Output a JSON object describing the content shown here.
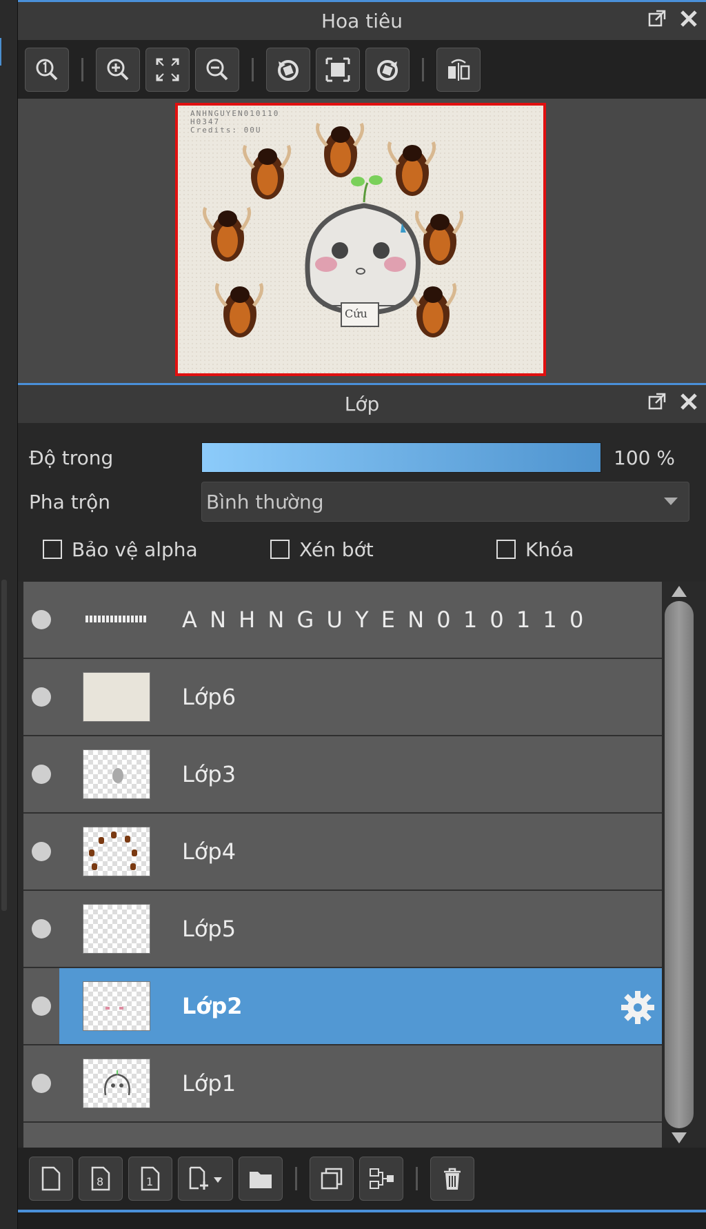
{
  "navigator": {
    "title": "Hoa tiêu",
    "preview_caption_lines": [
      "ANHNGUYEN010110",
      "H0347",
      "Credits: 00U"
    ],
    "preview_badge": "Cứu"
  },
  "layers_panel": {
    "title": "Lớp",
    "opacity_label": "Độ trong",
    "opacity_value": "100 %",
    "opacity_fraction": 1.0,
    "blend_label": "Pha trộn",
    "blend_value": "Bình thường",
    "checkbox_protect_alpha": "Bảo vệ alpha",
    "checkbox_clip": "Xén bớt",
    "checkbox_lock": "Khóa",
    "layers": [
      {
        "name": "A N H N G U Y E N 0 1 0 1 1 0",
        "thumb": "text"
      },
      {
        "name": "Lớp6",
        "thumb": "paper"
      },
      {
        "name": "Lớp3",
        "thumb": "blob"
      },
      {
        "name": "Lớp4",
        "thumb": "bugs"
      },
      {
        "name": "Lớp5",
        "thumb": "empty"
      },
      {
        "name": "Lớp2",
        "thumb": "cheeks",
        "selected": true
      },
      {
        "name": "Lớp1",
        "thumb": "ghost"
      }
    ]
  },
  "colors": {
    "accent": "#4a90d9",
    "selected": "#5298d3",
    "frame": "#e01010"
  }
}
